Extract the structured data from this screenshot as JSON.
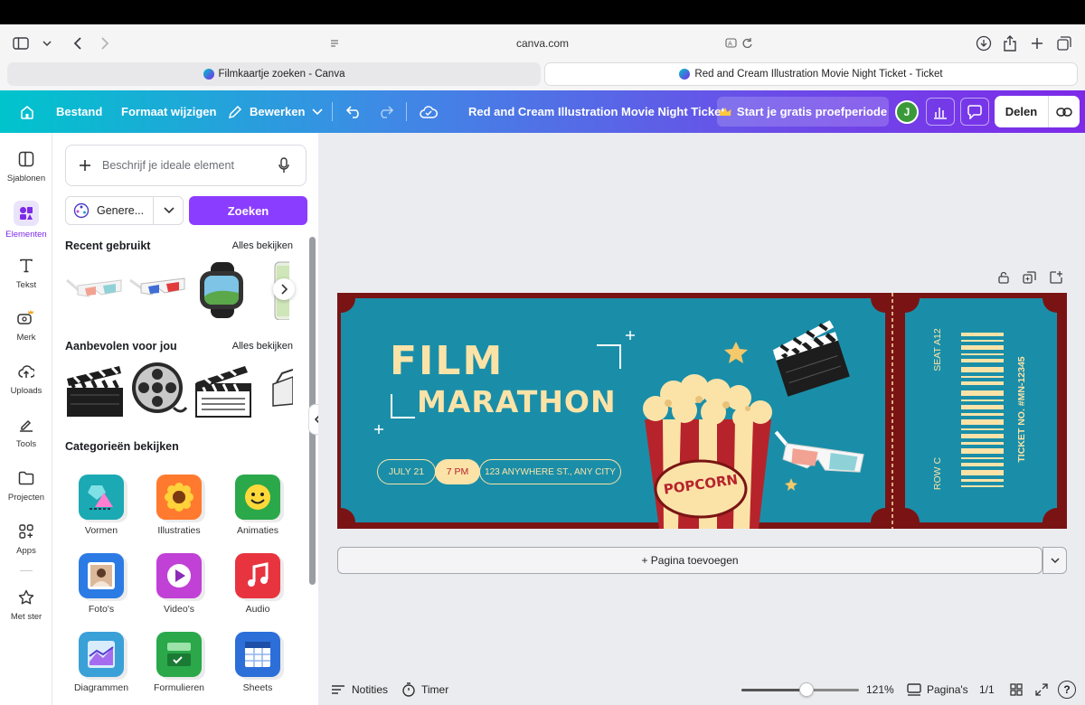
{
  "browser": {
    "url": "canva.com",
    "tabs": [
      {
        "label": "Filmkaartje zoeken - Canva",
        "active": false
      },
      {
        "label": "Red and Cream Illustration Movie Night Ticket - Ticket",
        "active": true
      }
    ]
  },
  "topbar": {
    "file": "Bestand",
    "resize": "Formaat wijzigen",
    "edit": "Bewerken",
    "doc_title": "Red and Cream Illustration Movie Night Ticket",
    "trial": "Start je gratis proefperiode",
    "avatar_letter": "J",
    "share": "Delen"
  },
  "rail": {
    "items": [
      {
        "label": "Sjablonen",
        "icon": "template-icon"
      },
      {
        "label": "Elementen",
        "icon": "elements-icon"
      },
      {
        "label": "Tekst",
        "icon": "text-icon"
      },
      {
        "label": "Merk",
        "icon": "brand-icon"
      },
      {
        "label": "Uploads",
        "icon": "upload-icon"
      },
      {
        "label": "Tools",
        "icon": "tools-icon"
      },
      {
        "label": "Projecten",
        "icon": "folder-icon"
      },
      {
        "label": "Apps",
        "icon": "apps-icon"
      },
      {
        "label": "Met ster",
        "icon": "star-icon"
      }
    ]
  },
  "panel": {
    "search_placeholder": "Beschrijf je ideale element",
    "generate_label": "Genere...",
    "search_button": "Zoeken",
    "recent_title": "Recent gebruikt",
    "recommended_title": "Aanbevolen voor jou",
    "see_all": "Alles bekijken",
    "categories_title": "Categorieën bekijken",
    "categories": [
      {
        "label": "Vormen",
        "color": "#1ba9b3"
      },
      {
        "label": "Illustraties",
        "color": "#ff7a2f"
      },
      {
        "label": "Animaties",
        "color": "#2aa84a"
      },
      {
        "label": "Foto's",
        "color": "#2c7be5"
      },
      {
        "label": "Video's",
        "color": "#c140d6"
      },
      {
        "label": "Audio",
        "color": "#e8343f"
      },
      {
        "label": "Diagrammen",
        "color": "#3aa0d8"
      },
      {
        "label": "Formulieren",
        "color": "#2aa84a"
      },
      {
        "label": "Sheets",
        "color": "#2c6fd9"
      }
    ]
  },
  "ticket": {
    "title_line1": "FILM",
    "title_line2": "MARATHON",
    "date": "JULY 21",
    "time": "7 PM",
    "address": "123 ANYWHERE ST., ANY CITY",
    "popcorn": "POPCORN",
    "seat": "SEAT A12",
    "row": "ROW C",
    "ticket_no": "TICKET NO. #MN-12345",
    "colors": {
      "frame": "#7a1414",
      "main": "#1a8ea8",
      "cream": "#fbe3a8"
    }
  },
  "canvas": {
    "add_page": "+ Pagina toevoegen"
  },
  "bottombar": {
    "notes": "Notities",
    "timer": "Timer",
    "zoom": "121%",
    "pages_label": "Pagina's",
    "page_count": "1/1",
    "zoom_level": 0.55
  }
}
